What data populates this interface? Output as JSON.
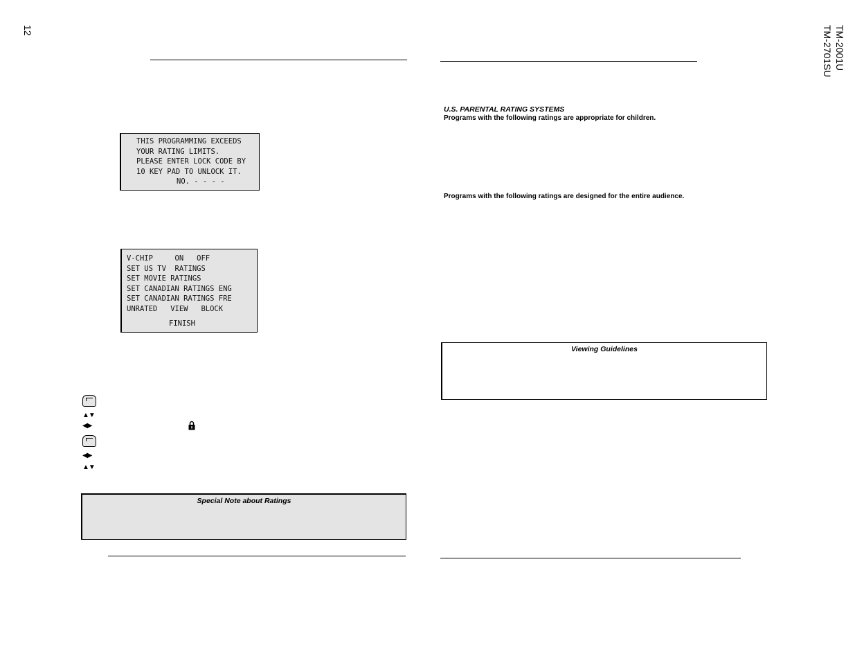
{
  "page_number": "12",
  "model_numbers": [
    "TM-2001U",
    "TM-2701SU"
  ],
  "left_page": {
    "lock_screen": {
      "lines": [
        "THIS PROGRAMMING EXCEEDS",
        "YOUR RATING LIMITS.",
        "PLEASE ENTER LOCK CODE BY",
        "10 KEY PAD TO UNLOCK IT.",
        "NO. - - - -"
      ]
    },
    "vchip_menu": {
      "lines": [
        "V-CHIP     ON   OFF",
        "SET US TV  RATINGS",
        "SET MOVIE RATINGS",
        "SET CANADIAN RATINGS ENG",
        "SET CANADIAN RATINGS FRE",
        "UNRATED   VIEW   BLOCK"
      ],
      "finish": "FINISH"
    },
    "steps": [
      {
        "icon": "menu-hand-icon"
      },
      {
        "icon": "up-down-arrows-icon",
        "glyph": "▲▼"
      },
      {
        "icon": "left-right-arrows-icon",
        "glyph": "◀▶"
      },
      {
        "icon": "menu-hand-icon"
      },
      {
        "icon": "left-right-arrows-icon",
        "glyph": "◀▶"
      },
      {
        "icon": "up-down-arrows-icon",
        "glyph": "▲▼"
      }
    ],
    "special_note": {
      "title": "Special Note about Ratings"
    }
  },
  "right_page": {
    "heading": "U.S. PARENTAL RATING SYSTEMS",
    "children_line": "Programs with the following ratings are appropriate for children.",
    "audience_line": "Programs with the following ratings are designed for the entire audience.",
    "viewing_guidelines": {
      "title": "Viewing Guidelines"
    }
  }
}
